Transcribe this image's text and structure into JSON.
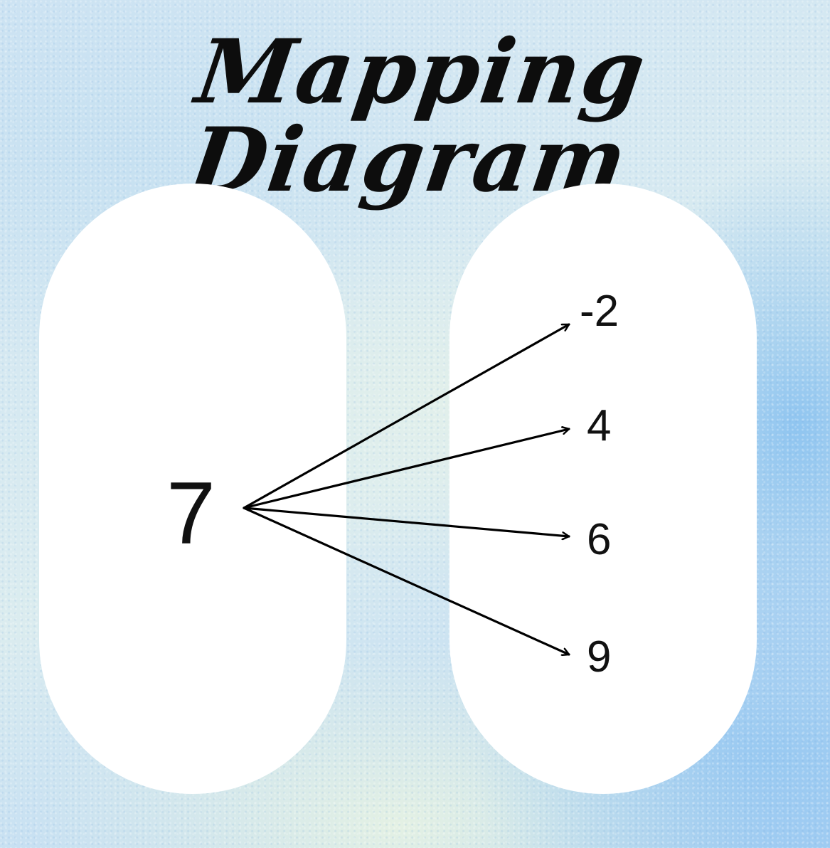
{
  "title": "Mapping Diagram",
  "domain": {
    "values": [
      "7"
    ]
  },
  "range": {
    "values": [
      "-2",
      "4",
      "6",
      "9"
    ]
  },
  "mappings": [
    {
      "from": "7",
      "to": "-2"
    },
    {
      "from": "7",
      "to": "4"
    },
    {
      "from": "7",
      "to": "6"
    },
    {
      "from": "7",
      "to": "9"
    }
  ],
  "colors": {
    "background": "#cfe4f3",
    "set_fill": "#ffffff",
    "text": "#111111",
    "arrow": "#000000"
  }
}
